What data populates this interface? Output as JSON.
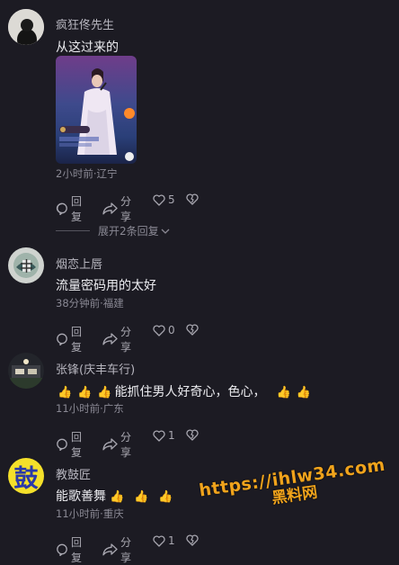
{
  "comments": [
    {
      "user": "疯狂佟先生",
      "text": "从这过来的",
      "meta": "2小时前·辽宁",
      "reply_label": "回复",
      "share_label": "分享",
      "likes": "5",
      "expand_label": "展开2条回复"
    },
    {
      "user": "烟恋上唇",
      "text": "流量密码用的太好",
      "meta": "38分钟前·福建",
      "reply_label": "回复",
      "share_label": "分享",
      "likes": "0"
    },
    {
      "user": "张锋(庆丰车行)",
      "text": "能抓住男人好奇心，色心，",
      "meta": "11小时前·广东",
      "reply_label": "回复",
      "share_label": "分享",
      "likes": "1"
    },
    {
      "user": "教鼓匠",
      "text": "能歌善舞",
      "meta": "11小时前·重庆",
      "reply_label": "回复",
      "share_label": "分享",
      "likes": "1",
      "avatar_char": "鼓"
    }
  ],
  "watermark": {
    "line1": "https://ihlw34.com",
    "line2": "黑料网"
  },
  "colors": {
    "background": "#1c1b23",
    "text": "#ececf0",
    "muted": "#8a8994",
    "watermark": "#f0a31c",
    "avatar_yellow": "#f4e02a"
  },
  "icons": [
    "comment-icon",
    "share-icon",
    "heart-icon",
    "dislike-heart-icon",
    "chevron-down-icon",
    "thumbs-up-emoji"
  ]
}
